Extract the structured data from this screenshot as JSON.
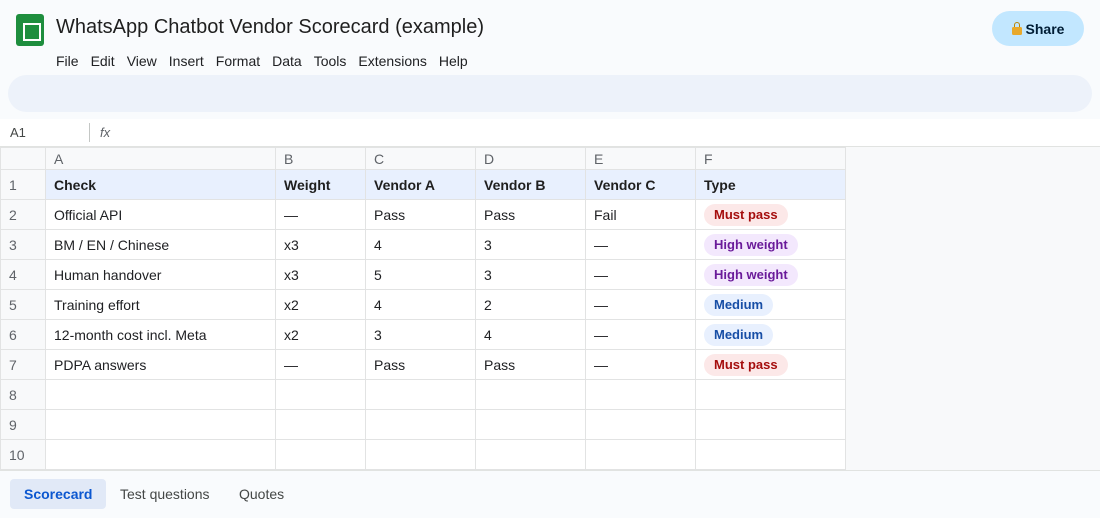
{
  "document": {
    "title": "WhatsApp Chatbot Vendor Scorecard (example)"
  },
  "menu": [
    "File",
    "Edit",
    "View",
    "Insert",
    "Format",
    "Data",
    "Tools",
    "Extensions",
    "Help"
  ],
  "share_button": {
    "label": "Share",
    "icon": "lock-icon"
  },
  "formula_bar": {
    "cell_ref": "A1",
    "fx_label": "fx",
    "value": ""
  },
  "columns": [
    "A",
    "B",
    "C",
    "D",
    "E",
    "F"
  ],
  "header_row": {
    "num": "1",
    "cells": [
      "Check",
      "Weight",
      "Vendor A",
      "Vendor B",
      "Vendor C",
      "Type"
    ]
  },
  "rows": [
    {
      "num": "2",
      "cells": [
        "Official API",
        "—",
        "Pass",
        "Pass",
        "Fail"
      ],
      "type": {
        "label": "Must pass",
        "bg": "#fce8e8",
        "fg": "#a50e0e"
      }
    },
    {
      "num": "3",
      "cells": [
        "BM / EN / Chinese",
        "x3",
        "4",
        "3",
        "—"
      ],
      "type": {
        "label": "High weight",
        "bg": "#f3e8fd",
        "fg": "#6a1b9a"
      }
    },
    {
      "num": "4",
      "cells": [
        "Human handover",
        "x3",
        "5",
        "3",
        "—"
      ],
      "type": {
        "label": "High weight",
        "bg": "#f3e8fd",
        "fg": "#6a1b9a"
      }
    },
    {
      "num": "5",
      "cells": [
        "Training effort",
        "x2",
        "4",
        "2",
        "—"
      ],
      "type": {
        "label": "Medium",
        "bg": "#e8f0fe",
        "fg": "#174ea6"
      }
    },
    {
      "num": "6",
      "cells": [
        "12-month cost incl. Meta",
        "x2",
        "3",
        "4",
        "—"
      ],
      "type": {
        "label": "Medium",
        "bg": "#e8f0fe",
        "fg": "#174ea6"
      }
    },
    {
      "num": "7",
      "cells": [
        "PDPA answers",
        "—",
        "Pass",
        "Pass",
        "—"
      ],
      "type": {
        "label": "Must pass",
        "bg": "#fce8e8",
        "fg": "#a50e0e"
      }
    }
  ],
  "empty_rows": [
    "8",
    "9",
    "10"
  ],
  "sheet_tabs": [
    {
      "label": "Scorecard",
      "active": true
    },
    {
      "label": "Test questions",
      "active": false
    },
    {
      "label": "Quotes",
      "active": false
    }
  ],
  "colors": {
    "accent": "#0b57d0",
    "app_icon": "#1e8e3e",
    "share_bg": "#c2e7ff"
  }
}
